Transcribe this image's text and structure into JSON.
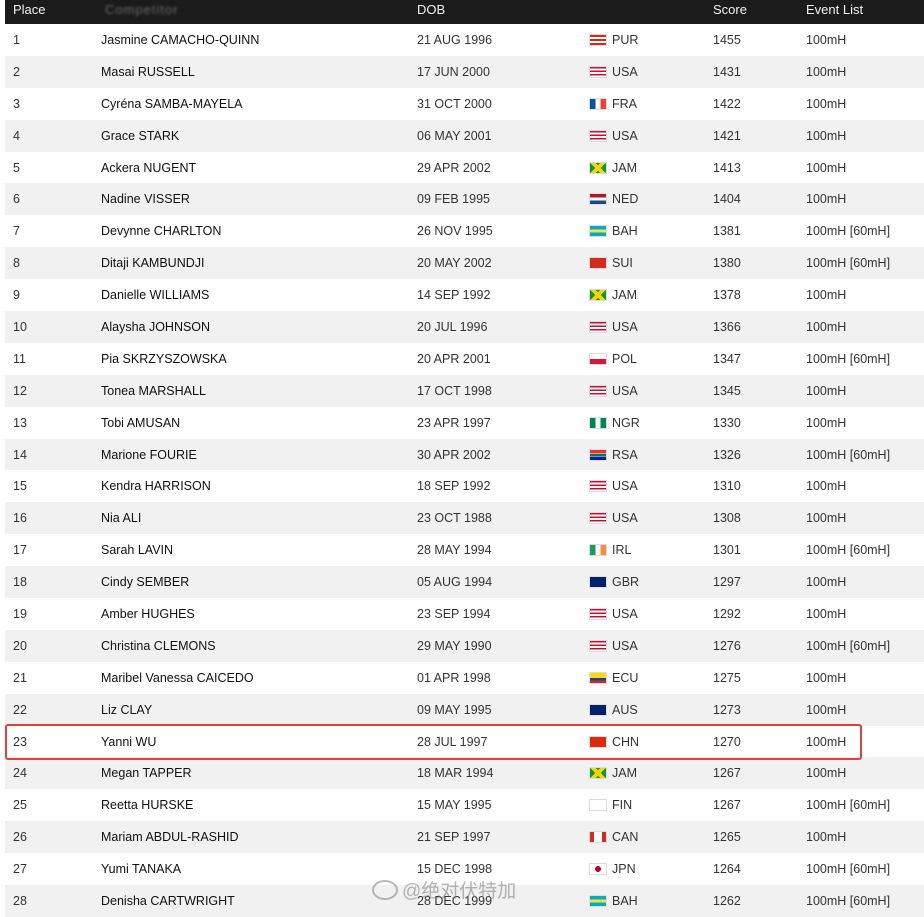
{
  "header": {
    "place": "Place",
    "name": "Competitor",
    "dob": "DOB",
    "score": "Score",
    "event_list": "Event List"
  },
  "rows": [
    {
      "place": "1",
      "name": "Jasmine CAMACHO-QUINN",
      "dob": "21 AUG 1996",
      "nat": "PUR",
      "score": "1455",
      "events": "100mH",
      "flag": "pur"
    },
    {
      "place": "2",
      "name": "Masai RUSSELL",
      "dob": "17 JUN 2000",
      "nat": "USA",
      "score": "1431",
      "events": "100mH",
      "flag": "usa"
    },
    {
      "place": "3",
      "name": "Cyréna SAMBA-MAYELA",
      "dob": "31 OCT 2000",
      "nat": "FRA",
      "score": "1422",
      "events": "100mH",
      "flag": "fra"
    },
    {
      "place": "4",
      "name": "Grace STARK",
      "dob": "06 MAY 2001",
      "nat": "USA",
      "score": "1421",
      "events": "100mH",
      "flag": "usa"
    },
    {
      "place": "5",
      "name": "Ackera NUGENT",
      "dob": "29 APR 2002",
      "nat": "JAM",
      "score": "1413",
      "events": "100mH",
      "flag": "jam"
    },
    {
      "place": "6",
      "name": "Nadine VISSER",
      "dob": "09 FEB 1995",
      "nat": "NED",
      "score": "1404",
      "events": "100mH",
      "flag": "ned"
    },
    {
      "place": "7",
      "name": "Devynne CHARLTON",
      "dob": "26 NOV 1995",
      "nat": "BAH",
      "score": "1381",
      "events": "100mH [60mH]",
      "flag": "bah"
    },
    {
      "place": "8",
      "name": "Ditaji KAMBUNDJI",
      "dob": "20 MAY 2002",
      "nat": "SUI",
      "score": "1380",
      "events": "100mH [60mH]",
      "flag": "sui"
    },
    {
      "place": "9",
      "name": "Danielle WILLIAMS",
      "dob": "14 SEP 1992",
      "nat": "JAM",
      "score": "1378",
      "events": "100mH",
      "flag": "jam"
    },
    {
      "place": "10",
      "name": "Alaysha JOHNSON",
      "dob": "20 JUL 1996",
      "nat": "USA",
      "score": "1366",
      "events": "100mH",
      "flag": "usa"
    },
    {
      "place": "11",
      "name": "Pia SKRZYSZOWSKA",
      "dob": "20 APR 2001",
      "nat": "POL",
      "score": "1347",
      "events": "100mH [60mH]",
      "flag": "pol"
    },
    {
      "place": "12",
      "name": "Tonea MARSHALL",
      "dob": "17 OCT 1998",
      "nat": "USA",
      "score": "1345",
      "events": "100mH",
      "flag": "usa"
    },
    {
      "place": "13",
      "name": "Tobi AMUSAN",
      "dob": "23 APR 1997",
      "nat": "NGR",
      "score": "1330",
      "events": "100mH",
      "flag": "ngr"
    },
    {
      "place": "14",
      "name": "Marione FOURIE",
      "dob": "30 APR 2002",
      "nat": "RSA",
      "score": "1326",
      "events": "100mH [60mH]",
      "flag": "rsa"
    },
    {
      "place": "15",
      "name": "Kendra HARRISON",
      "dob": "18 SEP 1992",
      "nat": "USA",
      "score": "1310",
      "events": "100mH",
      "flag": "usa"
    },
    {
      "place": "16",
      "name": "Nia ALI",
      "dob": "23 OCT 1988",
      "nat": "USA",
      "score": "1308",
      "events": "100mH",
      "flag": "usa"
    },
    {
      "place": "17",
      "name": "Sarah LAVIN",
      "dob": "28 MAY 1994",
      "nat": "IRL",
      "score": "1301",
      "events": "100mH [60mH]",
      "flag": "irl"
    },
    {
      "place": "18",
      "name": "Cindy SEMBER",
      "dob": "05 AUG 1994",
      "nat": "GBR",
      "score": "1297",
      "events": "100mH",
      "flag": "gbr"
    },
    {
      "place": "19",
      "name": "Amber HUGHES",
      "dob": "23 SEP 1994",
      "nat": "USA",
      "score": "1292",
      "events": "100mH",
      "flag": "usa"
    },
    {
      "place": "20",
      "name": "Christina CLEMONS",
      "dob": "29 MAY 1990",
      "nat": "USA",
      "score": "1276",
      "events": "100mH [60mH]",
      "flag": "usa"
    },
    {
      "place": "21",
      "name": "Maribel Vanessa CAICEDO",
      "dob": "01 APR 1998",
      "nat": "ECU",
      "score": "1275",
      "events": "100mH",
      "flag": "ecu"
    },
    {
      "place": "22",
      "name": "Liz CLAY",
      "dob": "09 MAY 1995",
      "nat": "AUS",
      "score": "1273",
      "events": "100mH",
      "flag": "aus"
    },
    {
      "place": "23",
      "name": "Yanni WU",
      "dob": "28 JUL 1997",
      "nat": "CHN",
      "score": "1270",
      "events": "100mH",
      "flag": "chn"
    },
    {
      "place": "24",
      "name": "Megan TAPPER",
      "dob": "18 MAR 1994",
      "nat": "JAM",
      "score": "1267",
      "events": "100mH",
      "flag": "jam"
    },
    {
      "place": "25",
      "name": "Reetta HURSKE",
      "dob": "15 MAY 1995",
      "nat": "FIN",
      "score": "1267",
      "events": "100mH [60mH]",
      "flag": "fin"
    },
    {
      "place": "26",
      "name": "Mariam ABDUL-RASHID",
      "dob": "21 SEP 1997",
      "nat": "CAN",
      "score": "1265",
      "events": "100mH",
      "flag": "can"
    },
    {
      "place": "27",
      "name": "Yumi TANAKA",
      "dob": "15 DEC 1998",
      "nat": "JPN",
      "score": "1264",
      "events": "100mH [60mH]",
      "flag": "jpn"
    },
    {
      "place": "28",
      "name": "Denisha CARTWRIGHT",
      "dob": "28 DEC 1999",
      "nat": "BAH",
      "score": "1262",
      "events": "100mH [60mH]",
      "flag": "bah"
    }
  ],
  "highlight_place": "23",
  "watermark": "@绝对伏特加",
  "colors": {
    "header_bg": "#1b1b1b",
    "stripe": "#f1f1f1",
    "highlight": "#e0403a"
  }
}
